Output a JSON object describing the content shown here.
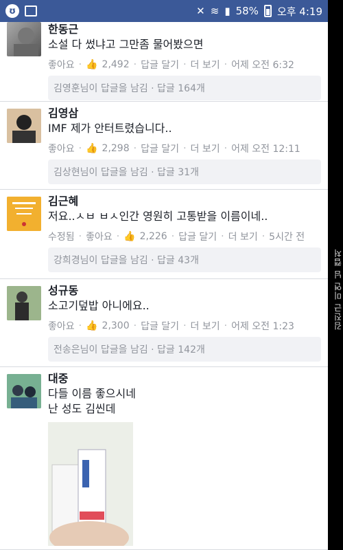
{
  "status_bar": {
    "battery_percent": "58%",
    "time": "오후 4:19"
  },
  "comments": [
    {
      "name": "한동근",
      "text": [
        "소설 다 썼냐고 그만좀 물어봤으면"
      ],
      "meta": [
        "좋아요",
        "2,492",
        "답글 달기",
        "더 보기",
        "어제 오전 6:32"
      ],
      "reply_summary": "김영훈님이 답글을 남김 · 답글 164개"
    },
    {
      "name": "김영삼",
      "text": [
        "IMF 제가 안터트렸습니다.."
      ],
      "meta": [
        "좋아요",
        "2,298",
        "답글 달기",
        "더 보기",
        "어제 오전 12:11"
      ],
      "reply_summary": "김상현님이 답글을 남김 · 답글 31개"
    },
    {
      "name": "김근혜",
      "text": [
        "저요..ㅅㅂ ㅂㅅ인간 영원히 고통받을 이름이네.."
      ],
      "meta": [
        "수정됨",
        "좋아요",
        "2,226",
        "답글 달기",
        "더 보기",
        "5시간 전"
      ],
      "reply_summary": "강희경님이 답글을 남김 · 답글 43개"
    },
    {
      "name": "성규동",
      "text": [
        "소고기덮밥 아니에요.."
      ],
      "meta": [
        "좋아요",
        "2,300",
        "답글 달기",
        "더 보기",
        "어제 오전 1:23"
      ],
      "reply_summary": "전송은님이 답글을 남김 · 답글 142개"
    },
    {
      "name": "대중",
      "text": [
        "다들 이름 좋으시네",
        "난 성도 김씬데"
      ],
      "meta": [],
      "reply_summary": ""
    }
  ],
  "watermark": "김진근 미연 님 캡처"
}
